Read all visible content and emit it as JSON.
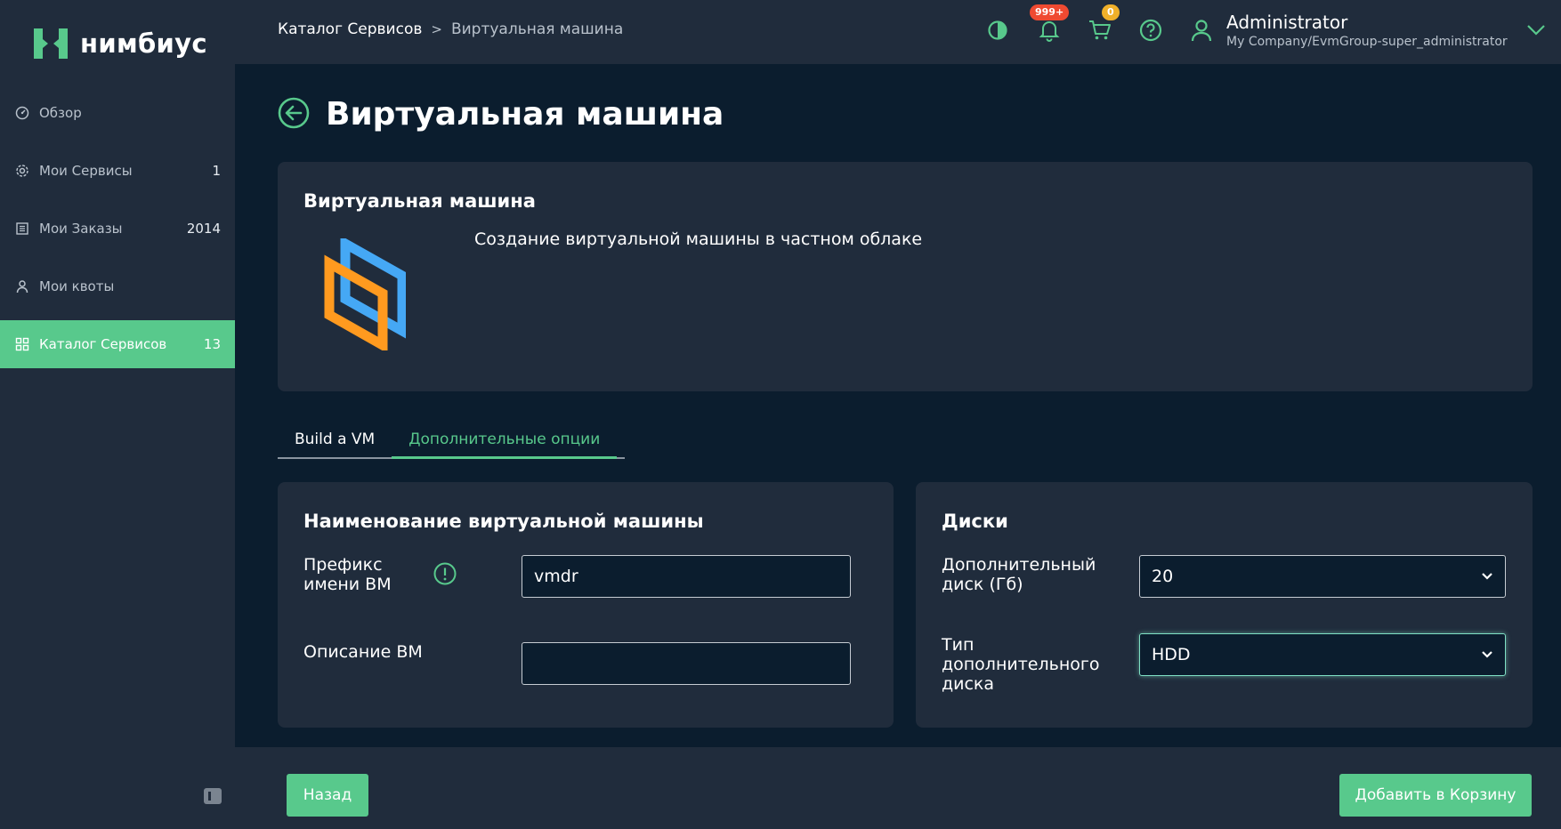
{
  "app": {
    "brand": "нимбиус"
  },
  "sidebar": {
    "items": [
      {
        "label": "Обзор",
        "count": "",
        "icon": "dashboard-icon"
      },
      {
        "label": "Мои Сервисы",
        "count": "1",
        "icon": "gear-icon"
      },
      {
        "label": "Мои Заказы",
        "count": "2014",
        "icon": "list-icon"
      },
      {
        "label": "Мои квоты",
        "count": "",
        "icon": "user-icon"
      },
      {
        "label": "Каталог Сервисов",
        "count": "13",
        "icon": "grid-icon",
        "active": true
      }
    ]
  },
  "header": {
    "breadcrumb": [
      "Каталог Сервисов",
      ">",
      "Виртуальная машина"
    ],
    "notifications_badge": "999+",
    "cart_badge": "0",
    "user_name": "Administrator",
    "user_org": "My Company/EvmGroup-super_administrator"
  },
  "page": {
    "title": "Виртуальная машина",
    "hero_title": "Виртуальная машина",
    "hero_description": "Создание виртуальной машины в частном облаке"
  },
  "tabs": [
    {
      "label": "Build a VM",
      "active": false
    },
    {
      "label": "Дополнительные опции",
      "active": true
    }
  ],
  "vm_name_section": {
    "title": "Наименование виртуальной машины",
    "prefix_label_line1": "Префикс",
    "prefix_label_line2": "имени ВМ",
    "prefix_value": "vmdr",
    "description_label": "Описание ВМ",
    "description_value": ""
  },
  "disks_section": {
    "title": "Диски",
    "extra_disk_label_line1": "Дополнительный",
    "extra_disk_label_line2": "диск (Гб)",
    "extra_disk_value": "20",
    "disk_type_label_line1": "Тип",
    "disk_type_label_line2": "дополнительного",
    "disk_type_label_line3": "диска",
    "disk_type_value": "HDD"
  },
  "footer": {
    "back_label": "Назад",
    "add_to_cart_label": "Добавить в Корзину"
  },
  "colors": {
    "accent": "#58c98c",
    "panel": "#202c3c",
    "background": "#0b1d2e",
    "badge_red": "#ef4a31",
    "badge_yellow": "#f0b02a",
    "logo_orange": "#ff9a1f",
    "logo_blue": "#45a8f5"
  }
}
